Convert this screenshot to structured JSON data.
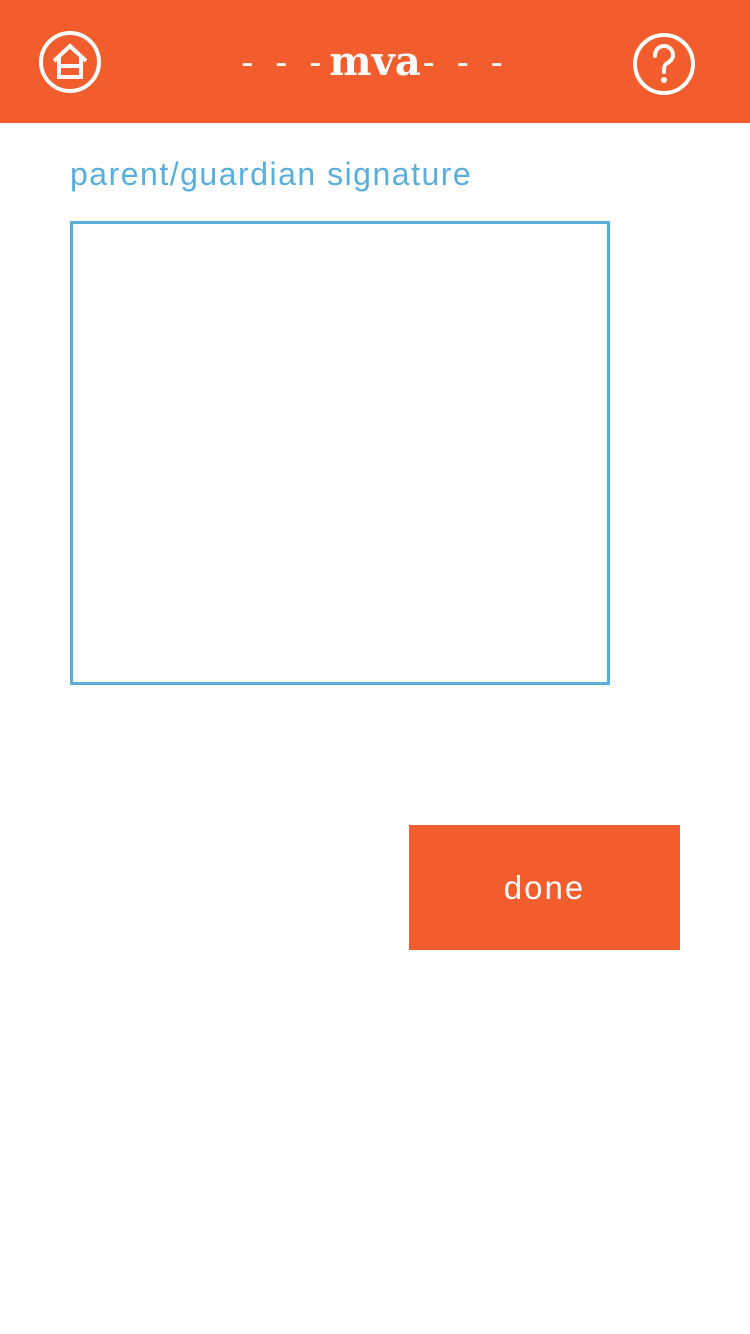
{
  "header": {
    "title_prefix": "- - -",
    "title": "mva",
    "title_suffix": "- - -",
    "home_icon": "home-icon",
    "help_icon": "help-icon",
    "background_color": "#f15d2c"
  },
  "signature": {
    "label": "parent/guardian signature",
    "border_color": "#5aaedc"
  },
  "actions": {
    "done_label": "done",
    "done_color": "#f15d2c"
  }
}
